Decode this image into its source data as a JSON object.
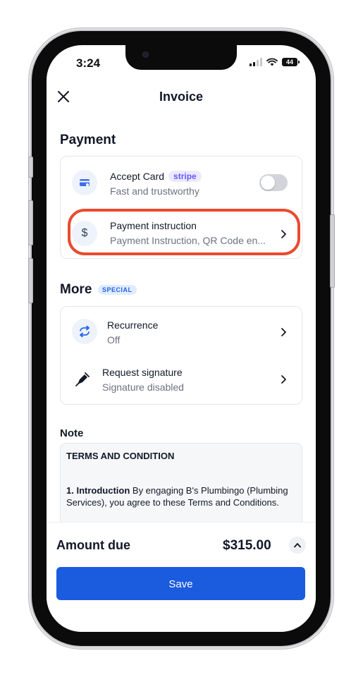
{
  "status_bar": {
    "time": "3:24",
    "battery": "44"
  },
  "header": {
    "title": "Invoice",
    "close_icon": "close-icon"
  },
  "payment": {
    "section_title": "Payment",
    "accept_card": {
      "title": "Accept Card",
      "badge": "stripe",
      "subtitle": "Fast and trustworthy",
      "enabled": false,
      "icon": "card-icon"
    },
    "payment_instruction": {
      "title": "Payment instruction",
      "subtitle": "Payment Instruction, QR Code en...",
      "icon": "dollar-icon",
      "highlighted": true
    }
  },
  "more": {
    "section_title": "More",
    "badge": "SPECIAL",
    "recurrence": {
      "title": "Recurrence",
      "subtitle": "Off",
      "icon": "repeat-icon"
    },
    "signature": {
      "title": "Request signature",
      "subtitle": "Signature disabled",
      "icon": "pen-icon"
    }
  },
  "note": {
    "label": "Note",
    "heading": "TERMS AND CONDITION",
    "intro_bold": "1. Introduction",
    "intro_text": " By engaging B's Plumbingo (Plumbing Services), you agree to these Terms and Conditions."
  },
  "footer": {
    "amount_label": "Amount due",
    "amount_value": "$315.00",
    "save_label": "Save"
  },
  "colors": {
    "accent": "#1b5bde",
    "highlight": "#ea4a2d",
    "stripe_badge": "#635bff",
    "special_badge": "#2563eb"
  }
}
